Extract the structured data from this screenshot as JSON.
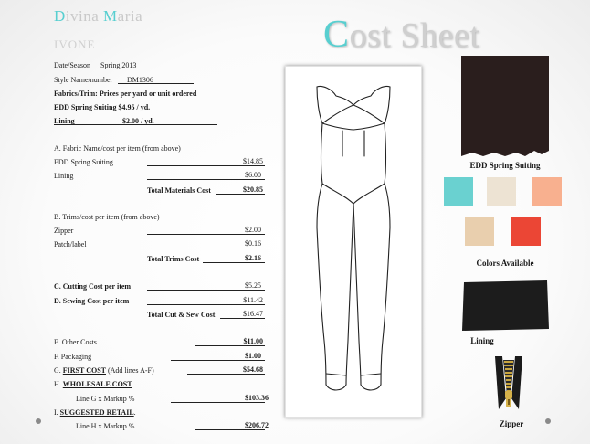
{
  "brand": {
    "first_initial": "D",
    "first_rest": "ivina ",
    "last_initial": "M",
    "last_rest": "aria"
  },
  "subtitle": "IVONE",
  "title": {
    "initial": "C",
    "rest": "ost Sheet"
  },
  "header": {
    "date_label": "Date/Season",
    "date_value": "Spring 2013",
    "style_label": "Style Name/number",
    "style_value": "DM1306",
    "fabrics_label": "Fabrics/Trim: Prices per yard or unit ordered",
    "edd_label": "EDD Spring Suiting $4.95 / yd.",
    "lining_label": "Lining",
    "lining_price": "$2.00 / yd."
  },
  "section_a": {
    "heading": "A. Fabric Name/cost per item (from above)",
    "rows": [
      {
        "label": "EDD Spring Suiting",
        "value": "$14.85"
      },
      {
        "label": "Lining",
        "value": "$6.00"
      }
    ],
    "total_label": "Total Materials Cost",
    "total_value": "$20.85"
  },
  "section_b": {
    "heading": "B. Trims/cost per item (from above)",
    "rows": [
      {
        "label": "Zipper",
        "value": "$2.00"
      },
      {
        "label": "Patch/label",
        "value": "$0.16"
      }
    ],
    "total_label": "Total Trims Cost",
    "total_value": "$2.16"
  },
  "section_cd": {
    "cutting_label": "C. Cutting Cost per item",
    "cutting_value": "$5.25",
    "sewing_label": "D. Sewing Cost per item",
    "sewing_value": "$11.42",
    "total_label": "Total Cut & Sew Cost",
    "total_value": "$16.47"
  },
  "section_e": {
    "other_label": "E. Other Costs",
    "other_value": "$11.00",
    "packaging_label": "F. Packaging",
    "packaging_value": "$1.00",
    "g_prefix": "G. ",
    "g_underlined": "FIRST COST",
    "g_note": " (Add lines A-F)",
    "g_value": "$54.68",
    "h_prefix": "H. ",
    "h_underlined": "WHOLESALE COST",
    "h_sub_label": "Line G x Markup %",
    "h_value": "$103.36",
    "i_prefix": "I. ",
    "i_underlined": "SUGGESTED RETAIL",
    "i_suffix": ".",
    "i_sub_label": "Line H x Markup %",
    "i_value": "$206.72"
  },
  "right_panel": {
    "fabric_caption": "EDD Spring Suiting",
    "colors_caption": "Colors Available",
    "lining_caption": "Lining",
    "zipper_caption": "Zipper",
    "colors": [
      "#6ad1d0",
      "#ede3d3",
      "#f8b08f",
      "#e9cfae",
      "#eb4635"
    ],
    "fabric_color": "#2a1e1d",
    "lining_color": "#1c1c1c"
  }
}
